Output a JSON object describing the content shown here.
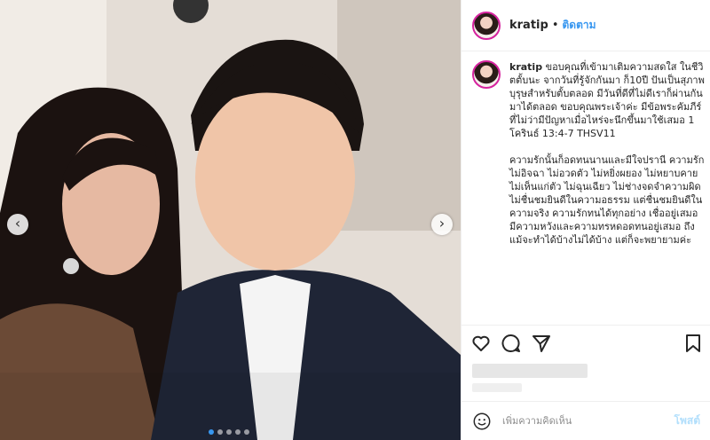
{
  "post": {
    "username": "kratip",
    "separator": "•",
    "follow_label": "ติดตาม",
    "caption": "ขอบคุณที่เข้ามาเติมความสดใส ในชีวิตตั้บนะ จากวันที่รู้จักกันมา ก็10ปี ปันเป็นสุภาพบุรุษสำหรับตั้บตลอด มีวันที่ดีที่ไม่ดีเราก็ผ่านกันมาได้ตลอด ขอบคุณพระเจ้าค่ะ มีข้อพระคัมภีร์ที่ไม่ว่ามีปัญหาเมื่อไหร่จะนึกขึ้นมาใช้เสมอ 1 โครินธ์ 13:4-7 THSV11\n\nความรักนั้นก็อดทนนานและมีใจปรานี ความรักไม่อิจฉา ไม่อวดตัว ไม่หยิ่งผยอง ไม่หยาบคาย ไม่เห็นแก่ตัว ไม่ฉุนเฉียว ไม่ช่างจดจำความผิด ไม่ชื่นชมยินดีในความอธรรม แต่ชื่นชมยินดีในความจริง ความรักทนได้ทุกอย่าง เชื่ออยู่เสมอ มีความหวังและความทรหดอดทนอยู่เสมอ ถึงแม้จะทำได้บ้างไม่ได้บ้าง แต่ก็จะพยายามค่ะ"
  },
  "comment": {
    "placeholder": "เพิ่มความคิดเห็น",
    "post_label": "โพสต์"
  },
  "icons": [
    "heart-icon",
    "comment-icon",
    "share-icon",
    "bookmark-icon",
    "smiley-icon",
    "chevron-left-icon",
    "chevron-right-icon"
  ],
  "colors": {
    "link": "#3897f0",
    "post_disabled": "#b2dffc",
    "text": "#262626"
  },
  "carousel": {
    "slide_count": 5,
    "active_index": 0
  }
}
